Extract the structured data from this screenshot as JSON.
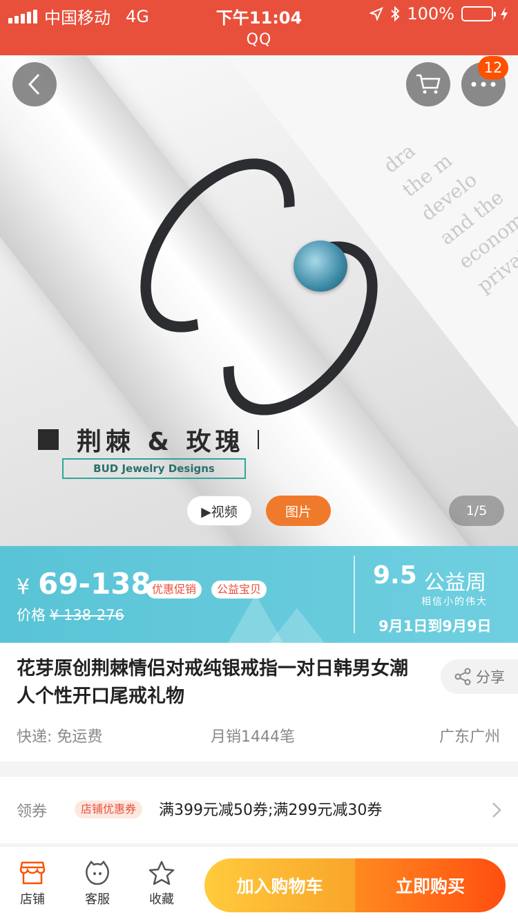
{
  "status_bar": {
    "carrier": "中国移动",
    "network": "4G",
    "time": "下午11:04",
    "battery": "100%",
    "app_name": "QQ"
  },
  "hero": {
    "brand_title": "荆棘 & 玫瑰",
    "brand_sub": "BUD Jewelry  Designs",
    "cart_badge": "12",
    "video_label": "▶视频",
    "image_label": "图片",
    "image_counter": "1/5",
    "background_text": [
      "dra",
      "the m",
      "develo",
      "and the",
      "economy",
      "private"
    ]
  },
  "price": {
    "currency": "¥",
    "range": "69-138",
    "tags": [
      "优惠促销",
      "公益宝贝"
    ],
    "original_label": "价格",
    "original_value": "¥ 138-276",
    "promo_logo": "9.5",
    "promo_title": "公益周",
    "promo_sub": "相信小的伟大",
    "promo_date": "9月1日到9月9日"
  },
  "product": {
    "title": "花芽原创荆棘情侣对戒纯银戒指一对日韩男女潮人个性开口尾戒礼物",
    "share_label": "分享",
    "shipping": "快递: 免运费",
    "monthly_sales": "月销1444笔",
    "location": "广东广州"
  },
  "coupon": {
    "label": "领券",
    "tag": "店铺优惠券",
    "text": "满399元减50券;满299元减30券"
  },
  "bottom_bar": {
    "store": "店铺",
    "service": "客服",
    "favorite": "收藏",
    "add_to_cart": "加入购物车",
    "buy_now": "立即购买"
  },
  "colors": {
    "header_red": "#e8503c",
    "accent_orange": "#ff5000",
    "promo_teal": "#59c4d6",
    "cart_yellow": "#f9a52a"
  },
  "icons": [
    "back-icon",
    "cart-icon",
    "more-icon",
    "share-icon",
    "chevron-right-icon",
    "store-icon",
    "service-icon",
    "star-icon",
    "location-arrow-icon",
    "bluetooth-icon",
    "charging-icon"
  ]
}
